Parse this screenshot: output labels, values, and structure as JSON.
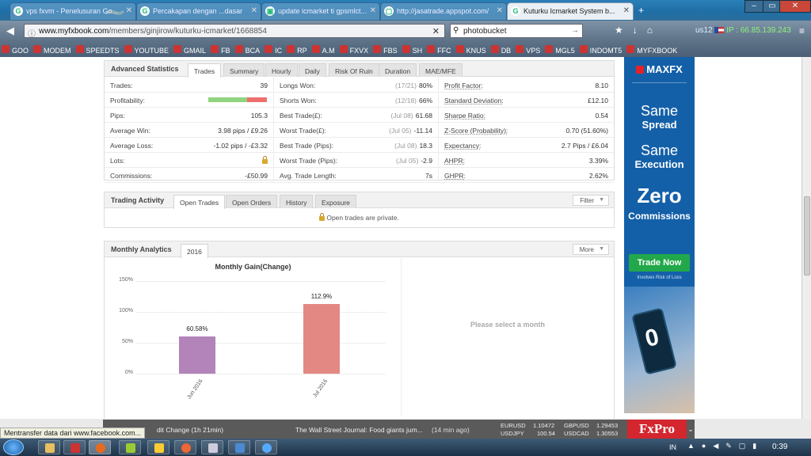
{
  "browser": {
    "tabs": [
      {
        "title": "vps fxvm - Penelusuran Go..."
      },
      {
        "title": "Percakapan dengan ...dasar"
      },
      {
        "title": "update icmarket ti gpsmlct..."
      },
      {
        "title": "http://jasatrade.appspot.com/"
      },
      {
        "title": "Kuturku Icmarket System b..."
      }
    ],
    "url_domain": "www.myfxbook.com",
    "url_path": "/members/ginjirow/kuturku-icmarket/1668854",
    "search_value": "photobucket",
    "ip_user": "us12",
    "ip_text": "IP : 66.85.139.243",
    "bookmarks": [
      "GOO",
      "MODEM",
      "SPEEDTS",
      "YOUTUBE",
      "GMAIL",
      "FB",
      "BCA",
      "IC",
      "RP",
      "A.M",
      "FXVX",
      "FBS",
      "SH",
      "FFC",
      "KNUS",
      "DB",
      "VPS",
      "MGL5",
      "INDOMT5",
      "MYFXBOOK"
    ]
  },
  "advanced": {
    "title": "Advanced Statistics",
    "tabs": [
      "Trades",
      "Summary",
      "Hourly",
      "Daily",
      "Risk Of Ruin",
      "Duration",
      "MAE/MFE"
    ],
    "col1": [
      {
        "label": "Trades:",
        "value": "39"
      },
      {
        "label": "Profitability:",
        "value": ""
      },
      {
        "label": "Pips:",
        "value": "105.3"
      },
      {
        "label": "Average Win:",
        "value": "3.98 pips / £9.26"
      },
      {
        "label": "Average Loss:",
        "value": "-1.02 pips / -£3.32"
      },
      {
        "label": "Lots:",
        "value": ""
      },
      {
        "label": "Commissions:",
        "value": "-£50.99"
      }
    ],
    "profitability_fraction": 0.66,
    "col2": [
      {
        "label": "Longs Won:",
        "detail": "(17/21)",
        "value": "80%"
      },
      {
        "label": "Shorts Won:",
        "detail": "(12/18)",
        "value": "66%"
      },
      {
        "label": "Best Trade(£):",
        "detail": "(Jul 08)",
        "value": "61.68"
      },
      {
        "label": "Worst Trade(£):",
        "detail": "(Jul 05)",
        "value": "-11.14"
      },
      {
        "label": "Best Trade (Pips):",
        "detail": "(Jul 08)",
        "value": "18.3"
      },
      {
        "label": "Worst Trade (Pips):",
        "detail": "(Jul 05)",
        "value": "-2.9"
      },
      {
        "label": "Avg. Trade Length:",
        "detail": "",
        "value": "7s"
      }
    ],
    "col3": [
      {
        "label": "Profit Factor:",
        "value": "8.10"
      },
      {
        "label": "Standard Deviation:",
        "value": "£12.10"
      },
      {
        "label": "Sharpe Ratio:",
        "value": "0.54"
      },
      {
        "label": "Z-Score (Probability):",
        "value": "0.70 (51.60%)"
      },
      {
        "label": "Expectancy:",
        "value": "2.7 Pips / £6.04"
      },
      {
        "label": "AHPR:",
        "value": "3.39%"
      },
      {
        "label": "GHPR:",
        "value": "2.62%"
      }
    ]
  },
  "activity": {
    "title": "Trading Activity",
    "tabs": [
      "Open Trades",
      "Open Orders",
      "History",
      "Exposure"
    ],
    "filter_label": "Filter",
    "private_msg": "Open trades are private."
  },
  "monthly": {
    "title": "Monthly Analytics",
    "year_tab": "2016",
    "more_label": "More",
    "select_msg": "Please select a month"
  },
  "chart_data": {
    "type": "bar",
    "title": "Monthly Gain(Change)",
    "categories": [
      "Jun 2016",
      "Jul 2016"
    ],
    "values": [
      60.58,
      112.9
    ],
    "value_labels": [
      "60.58%",
      "112.9%"
    ],
    "colors": [
      "#b384b9",
      "#e48883"
    ],
    "ylim": [
      0,
      150
    ],
    "yticks": [
      "0%",
      "50%",
      "100%",
      "150%"
    ],
    "grid": true
  },
  "ad": {
    "brand": "MAXFX",
    "line1a": "Same",
    "line1b": "Spread",
    "line2a": "Same",
    "line2b": "Execution",
    "line3a": "Zero",
    "line3b": "Commissions",
    "cta": "Trade Now",
    "risk": "Involves Risk of Loss",
    "phone_digit": "0"
  },
  "ticker": {
    "news1": "dit Change (1h 21min)",
    "news2": "The Wall Street Journal: Food giants jum...",
    "news2_time": "(14 min ago)",
    "pairs": [
      {
        "sym": "EURUSD",
        "val": "1.10472"
      },
      {
        "sym": "GBPUSD",
        "val": "1.29453"
      },
      {
        "sym": "USDJPY",
        "val": "100.54"
      },
      {
        "sym": "USDCAD",
        "val": "1.30553"
      }
    ],
    "brand": "FxPro"
  },
  "status": "Mentransfer data dari www.facebook.com...",
  "taskbar": {
    "lang": "IN",
    "clock": "0:39"
  }
}
